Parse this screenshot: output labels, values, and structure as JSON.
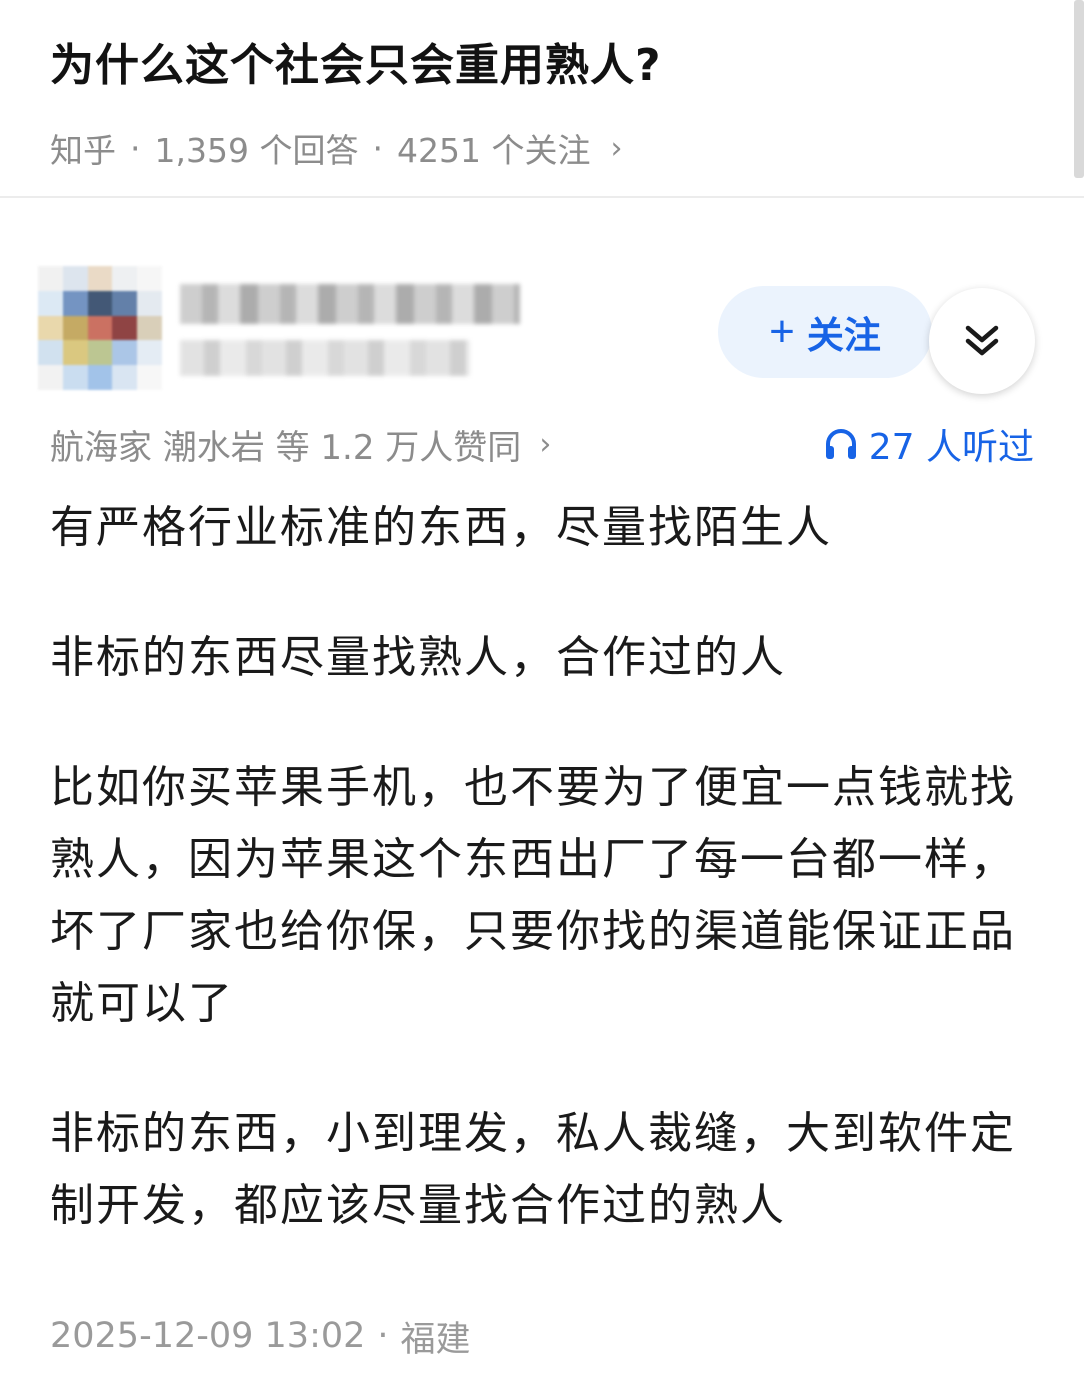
{
  "question": {
    "title": "为什么这个社会只会重用熟人?",
    "source": "知乎",
    "answers_count": "1,359 个回答",
    "followers_count": "4251 个关注",
    "separator": "·",
    "chevron": "›"
  },
  "author": {
    "follow_label": "关注",
    "follow_plus": "+",
    "expand_icon": "double-chevron-down-icon",
    "avatar_colors": [
      "#f1f1f1",
      "#dce4ee",
      "#e9d9c4",
      "#eef0f2",
      "#f6f6f6",
      "#dbe8f4",
      "#6d8fbf",
      "#39506f",
      "#5b7aa5",
      "#e3e9f0",
      "#e8d6a8",
      "#c2a65c",
      "#c96a5a",
      "#8a3a3a",
      "#d8cdb6",
      "#cfe0ef",
      "#d9c67a",
      "#b9c48d",
      "#a7c3e6",
      "#e3ebf4",
      "#f2f2f2",
      "#c8dcf0",
      "#9ec0e8",
      "#d7e4f2",
      "#f7f7f7"
    ],
    "accent_color": "#1763e6"
  },
  "approval": {
    "text": "航海家 潮水岩 等 1.2 万人赞同",
    "chevron": "›"
  },
  "listen": {
    "icon": "headphones-icon",
    "text": "27 人听过"
  },
  "answer": {
    "paragraphs": [
      "有严格行业标准的东西，尽量找陌生人",
      "非标的东西尽量找熟人，合作过的人",
      "比如你买苹果手机，也不要为了便宜一点钱就找熟人，因为苹果这个东西出厂了每一台都一样，坏了厂家也给你保，只要你找的渠道能保证正品就可以了",
      "非标的东西，小到理发，私人裁缝，大到软件定制开发，都应该尽量找合作过的熟人"
    ],
    "timestamp": "2025-12-09 13:02",
    "location": "福建",
    "separator": "·"
  }
}
